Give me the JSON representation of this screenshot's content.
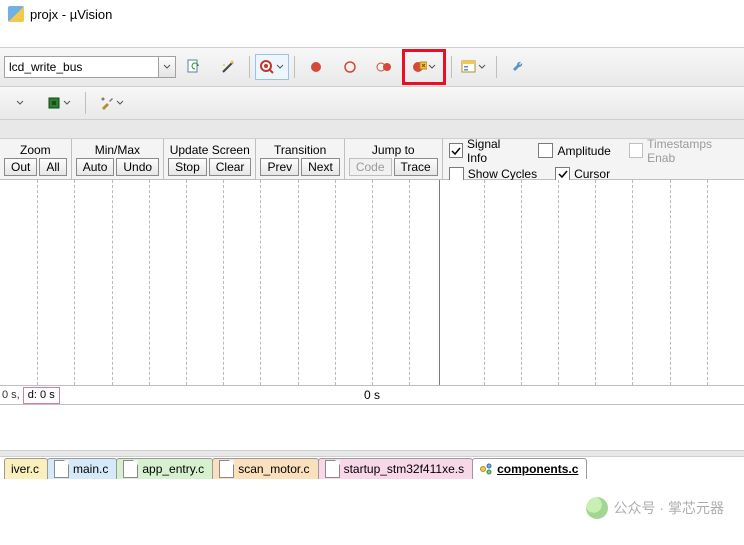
{
  "title": "projx - µVision",
  "toolbar": {
    "combo_value": "lcd_write_bus"
  },
  "la": {
    "zoom": {
      "label": "Zoom",
      "out": "Out",
      "all": "All"
    },
    "minmax": {
      "label": "Min/Max",
      "auto": "Auto",
      "undo": "Undo"
    },
    "update": {
      "label": "Update Screen",
      "stop": "Stop",
      "clear": "Clear"
    },
    "trans": {
      "label": "Transition",
      "prev": "Prev",
      "next": "Next"
    },
    "jump": {
      "label": "Jump to",
      "code": "Code",
      "trace": "Trace"
    },
    "checks": {
      "signal": "Signal Info",
      "amplitude": "Amplitude",
      "timestamps": "Timestamps Enab",
      "show_cycles": "Show Cycles",
      "cursor": "Cursor"
    }
  },
  "time": {
    "left": "0 s,   d: 0 s",
    "center": "0 s"
  },
  "tabs": {
    "t0": "iver.c",
    "t1": "main.c",
    "t2": "app_entry.c",
    "t3": "scan_motor.c",
    "t4": "startup_stm32f411xe.s",
    "t5": "components.c"
  },
  "watermark": "公众号 · 掌芯元器"
}
